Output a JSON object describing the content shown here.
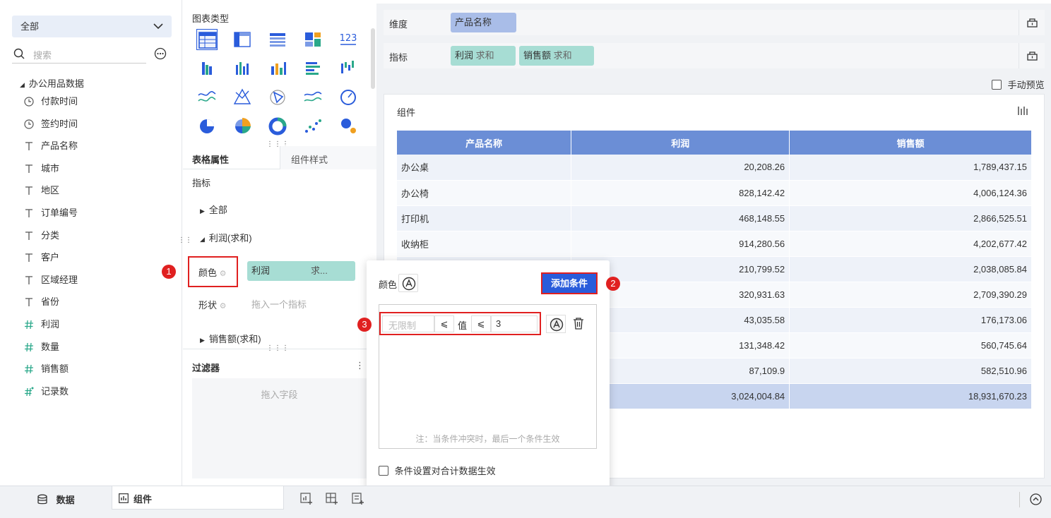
{
  "left": {
    "select_label": "全部",
    "search_placeholder": "搜索",
    "dataset": "办公用品数据",
    "fields": [
      {
        "type": "time",
        "label": "付款时间"
      },
      {
        "type": "time",
        "label": "签约时间"
      },
      {
        "type": "text",
        "label": "产品名称"
      },
      {
        "type": "text",
        "label": "城市"
      },
      {
        "type": "text",
        "label": "地区"
      },
      {
        "type": "text",
        "label": "订单编号"
      },
      {
        "type": "text",
        "label": "分类"
      },
      {
        "type": "text",
        "label": "客户"
      },
      {
        "type": "text",
        "label": "区域经理"
      },
      {
        "type": "text",
        "label": "省份"
      },
      {
        "type": "num",
        "label": "利润"
      },
      {
        "type": "num",
        "label": "数量"
      },
      {
        "type": "num",
        "label": "销售额"
      },
      {
        "type": "numcalc",
        "label": "记录数"
      }
    ]
  },
  "mid": {
    "chart_type_title": "图表类型",
    "tabs": {
      "props": "表格属性",
      "style": "组件样式"
    },
    "metrics_label": "指标",
    "tree_all": "全部",
    "tree_profit": "利润(求和)",
    "color_label": "颜色",
    "color_chip": "利润",
    "color_chip_suffix": "求...",
    "shape_label": "形状",
    "shape_placeholder": "拖入一个指标",
    "tree_sales": "销售额(求和)",
    "filter_label": "过滤器",
    "filter_placeholder": "拖入字段"
  },
  "right": {
    "dim_label": "维度",
    "dim_chip": "产品名称",
    "metric_label": "指标",
    "metric_chips": [
      {
        "name": "利润",
        "agg": "求和"
      },
      {
        "name": "销售额",
        "agg": "求和"
      }
    ],
    "manual_preview": "手动预览",
    "component_title": "组件",
    "table": {
      "headers": [
        "产品名称",
        "利润",
        "销售额"
      ],
      "rows": [
        [
          "办公桌",
          "20,208.26",
          "1,789,437.15"
        ],
        [
          "办公椅",
          "828,142.42",
          "4,006,124.36"
        ],
        [
          "打印机",
          "468,148.55",
          "2,866,525.51"
        ],
        [
          "收纳柜",
          "914,280.56",
          "4,202,677.42"
        ],
        [
          "",
          "210,799.52",
          "2,038,085.84"
        ],
        [
          "",
          "320,931.63",
          "2,709,390.29"
        ],
        [
          "",
          "43,035.58",
          "176,173.06"
        ],
        [
          "",
          "131,348.42",
          "560,745.64"
        ],
        [
          "",
          "87,109.9",
          "582,510.96"
        ]
      ],
      "total": [
        "",
        "3,024,004.84",
        "18,931,670.23"
      ]
    }
  },
  "popup": {
    "color_label": "颜色",
    "add_condition": "添加条件",
    "cond_placeholder": "无限制",
    "op1": "⩽",
    "value_label": "值",
    "op2": "⩽",
    "value": "3",
    "note": "注：当条件冲突时，最后一个条件生效",
    "checkbox_label": "条件设置对合计数据生效"
  },
  "badges": [
    "1",
    "2",
    "3"
  ],
  "bottom": {
    "data_tab": "数据",
    "component_tab": "组件"
  },
  "colors": {
    "accent": "#2a5cdb",
    "header_blue": "#6b8ed6",
    "chip_blue": "#a9bde8",
    "chip_teal": "#a7ddd4",
    "red": "#e02020"
  }
}
